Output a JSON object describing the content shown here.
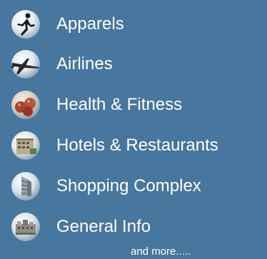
{
  "menu": {
    "items": [
      {
        "label": "Apparels",
        "icon": "runner-icon"
      },
      {
        "label": "Airlines",
        "icon": "airplane-icon"
      },
      {
        "label": "Health & Fitness",
        "icon": "apples-icon"
      },
      {
        "label": "Hotels & Restaurants",
        "icon": "hotel-building-icon"
      },
      {
        "label": "Shopping Complex",
        "icon": "shopping-building-icon"
      },
      {
        "label": "General Info",
        "icon": "general-info-icon"
      }
    ],
    "more_label": "and more....."
  },
  "colors": {
    "background": "#47769e",
    "text": "#ffffff"
  }
}
